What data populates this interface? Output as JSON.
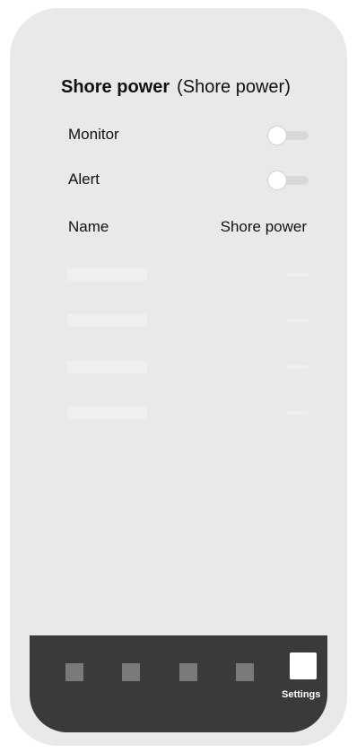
{
  "header": {
    "title": "Shore power",
    "subtitle": "(Shore power)"
  },
  "settings": {
    "monitor": {
      "label": "Monitor",
      "enabled": false
    },
    "alert": {
      "label": "Alert",
      "enabled": false
    }
  },
  "table": {
    "col_name": "Name",
    "col_value": "Shore power",
    "placeholder_rows": 4
  },
  "tabbar": {
    "settings_label": "Settings"
  },
  "colors": {
    "frame": "#e9e9e9",
    "tabbar": "#3a3a3a",
    "tab_inactive": "#7a7a7a",
    "placeholder": "#efefef"
  }
}
